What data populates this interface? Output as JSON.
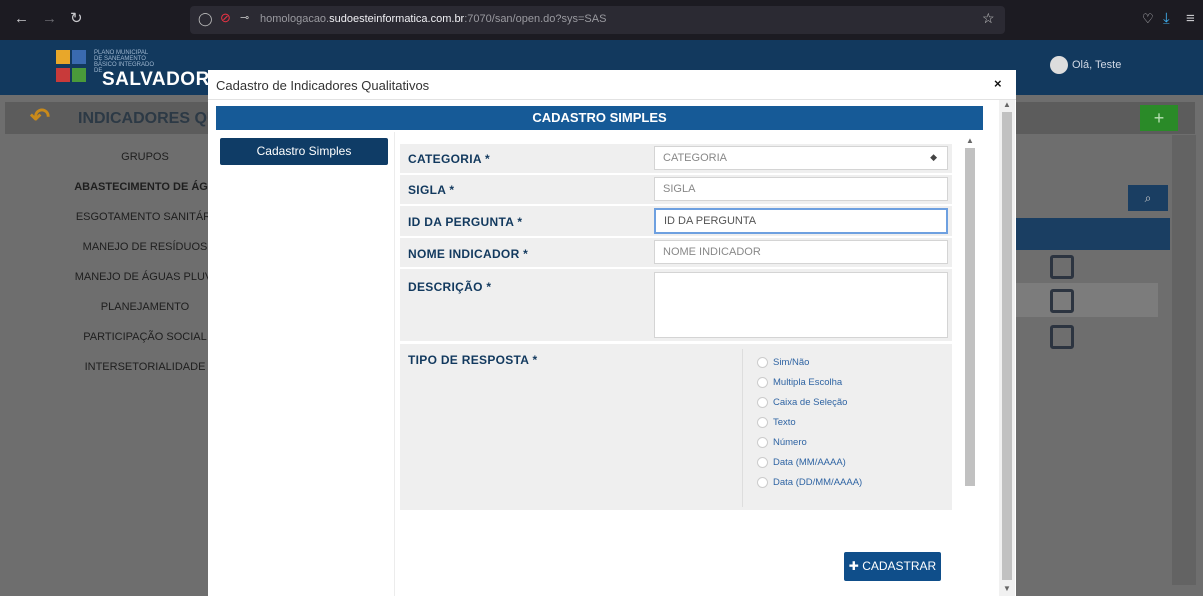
{
  "browser": {
    "url_prefix": "homologacao.",
    "url_domain": "sudoesteinformatica.com.br",
    "url_path": ":7070/san/open.do?sys=SAS"
  },
  "app": {
    "logo_small": "PLANO MUNICIPAL DE SANEAMENTO BÁSICO INTEGRADO DE",
    "logo_big": "SALVADOR",
    "user_greeting": "Olá, Teste"
  },
  "page": {
    "title": "INDICADORES QU",
    "add_label": "+",
    "menu": [
      "GRUPOS",
      "ABASTECIMENTO DE ÁGU",
      "ESGOTAMENTO SANITÁRI",
      "MANEJO DE RESÍDUOS",
      "MANEJO DE ÁGUAS PLUVI",
      "PLANEJAMENTO",
      "PARTICIPAÇÃO SOCIAL",
      "INTERSETORIALIDADE"
    ]
  },
  "modal": {
    "title": "Cadastro de Indicadores Qualitativos",
    "close": "×",
    "section_title": "CADASTRO SIMPLES",
    "side_tab": "Cadastro Simples",
    "fields": {
      "categoria": {
        "label": "CATEGORIA *",
        "value": "CATEGORIA"
      },
      "sigla": {
        "label": "SIGLA *",
        "placeholder": "SIGLA"
      },
      "id_pergunta": {
        "label": "ID DA PERGUNTA *",
        "placeholder": "ID DA PERGUNTA"
      },
      "nome": {
        "label": "NOME INDICADOR *",
        "placeholder": "NOME INDICADOR"
      },
      "descricao": {
        "label": "DESCRIÇÃO *"
      },
      "tipo": {
        "label": "TIPO DE RESPOSTA *"
      }
    },
    "response_types": [
      "Sim/Não",
      "Multipla Escolha",
      "Caixa de Seleção",
      "Texto",
      "Número",
      "Data (MM/AAAA)",
      "Data (DD/MM/AAAA)"
    ],
    "submit": "CADASTRAR"
  }
}
